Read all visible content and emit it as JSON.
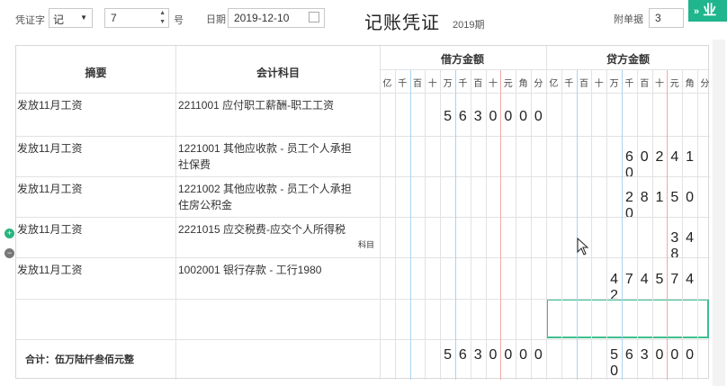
{
  "header": {
    "voucher_word_label": "凭证字",
    "voucher_word_value": "记",
    "voucher_no": "7",
    "no_label": "号",
    "date_label": "日期",
    "date_value": "2019-12-10",
    "title": "记账凭证",
    "period": "2019期",
    "attachments_label": "附单据",
    "attachments_value": "3",
    "action_label": "业"
  },
  "table": {
    "col_summary": "摘要",
    "col_account": "会计科目",
    "col_debit": "借方金额",
    "col_credit": "贷方金额",
    "digit_units": [
      "亿",
      "千",
      "百",
      "十",
      "万",
      "千",
      "百",
      "十",
      "元",
      "角",
      "分"
    ],
    "rows": [
      {
        "summary": "发放11月工资",
        "account": "2211001 应付职工薪酬-职工工资",
        "debit": "5630000",
        "credit": ""
      },
      {
        "summary": "发放11月工资",
        "account": "1221001 其他应收款 - 员工个人承担社保费",
        "debit": "",
        "credit": "602410"
      },
      {
        "summary": "发放11月工资",
        "account": "1221002 其他应收款 - 员工个人承担住房公积金",
        "debit": "",
        "credit": "281500"
      },
      {
        "summary": "发放11月工资",
        "account": "2221015 应交税费-应交个人所得税",
        "debit": "",
        "credit": "348"
      },
      {
        "summary": "发放11月工资",
        "account": "1002001 银行存款 - 工行1980",
        "debit": "",
        "credit": "4745742"
      },
      {
        "summary": "",
        "account": "",
        "debit": "",
        "credit": ""
      }
    ],
    "account_hint": "科目",
    "total_label": "合计：伍万陆仟叁佰元整",
    "total_debit": "5630000",
    "total_credit": "5630000"
  }
}
